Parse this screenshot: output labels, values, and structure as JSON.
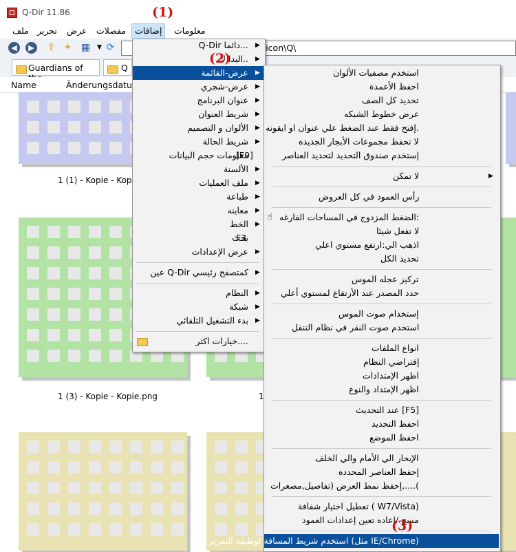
{
  "window": {
    "title": "Q-Dir 11.86"
  },
  "menubar": [
    "ملف",
    "تحرير",
    "عرض",
    "مفضلات",
    "إضافات",
    "معلومات"
  ],
  "address": {
    "value": "\\icon\\Q\\"
  },
  "tabs": [
    {
      "label": "Guardians of the ..."
    },
    {
      "label": "Q"
    }
  ],
  "columns": {
    "name": "Name",
    "date": "Änderungsdatum"
  },
  "thumbnails": [
    {
      "label": "1 (1) - Kopie - Kopie.png"
    },
    {
      "label": "1 (3) - Kopie - Kopie.png"
    },
    {
      "label": "1"
    }
  ],
  "callouts": [
    "(1)",
    "(2)",
    "(3)"
  ],
  "main_menu": [
    {
      "label": "Q-Dir دائما...",
      "submenu": true
    },
    {
      "label": "البدا ك..",
      "submenu": true
    },
    {
      "label": "عرض-القائمة",
      "submenu": true,
      "highlight": true
    },
    {
      "label": "عرض-شجري",
      "submenu": true
    },
    {
      "label": "عنوان البرنامج",
      "submenu": true
    },
    {
      "label": "شريط العنوان",
      "submenu": true
    },
    {
      "label": "الألوان و التصميم",
      "submenu": true
    },
    {
      "label": "شريط الحالة",
      "submenu": true
    },
    {
      "label": "معلومات حجم البيانات",
      "accel": "[F9]"
    },
    {
      "label": "الألسنة",
      "submenu": true
    },
    {
      "label": "ملف العمليات",
      "submenu": true
    },
    {
      "label": "طباعة",
      "submenu": true
    },
    {
      "label": "معاينه",
      "submenu": true
    },
    {
      "label": "الخط",
      "submenu": true
    },
    {
      "label": "بحث",
      "accel": "F3"
    },
    {
      "label": "عرض الإعدادات",
      "submenu": true
    },
    {
      "label": "عين Q-Dir كمتصفح رئيسي",
      "submenu": true
    },
    {
      "label": "النظام",
      "submenu": true
    },
    {
      "label": "شبكة",
      "submenu": true
    },
    {
      "label": "بدء التشغيل التلقائي",
      "submenu": true
    },
    {
      "label": "خيارات اكثر...."
    }
  ],
  "sub_menu": [
    "استخدم مصفيات الألوان",
    "احفظ الأعمدة",
    "تحديد كل الصف",
    "عرض خطوط الشبكه",
    "إفتح فقط عند الضغط علي عنوان او ايقونه.",
    "لا تحفظ مجموعات الأبجار الجديده",
    "إستخدم صندوق التحديد لتحديد العناصر",
    "لا تمكن",
    "رأس العمود في كل العروض",
    "الضغط المزدوج في المساحات الفارغه:",
    "لا تفعل شيئا",
    "اذهب الي:ارتفع مستوي اعلي",
    "تحديد الكل",
    "تركيز عجله الموس",
    "حدد المصدر عند الأرتفاع لمستوي أعلي",
    "إستخدام صوت الموس",
    "استخدم صوت النقر في نظام التنقل",
    "انواع الملفات",
    "إفتراضي النظام",
    "اظهر الإمتدادات",
    "اظهر الإمتداد والنوع",
    "عند التحديث [F5]",
    "احفظ التحديد",
    "احفظ الموضع",
    "الإبحار الي الأمام والي الخلف",
    "إحفظ العناصر المحدده",
    "إحفظ نمط العرض (تفاصيل,مصغرات,....(",
    "تعطيل اختيار شفافة ( W7/Vista)",
    "مسح /إعاده تعين إعدادات العمود",
    "استخدم شريط المسافة لوظيفة التمرير (مثل IE/Chrome)"
  ]
}
